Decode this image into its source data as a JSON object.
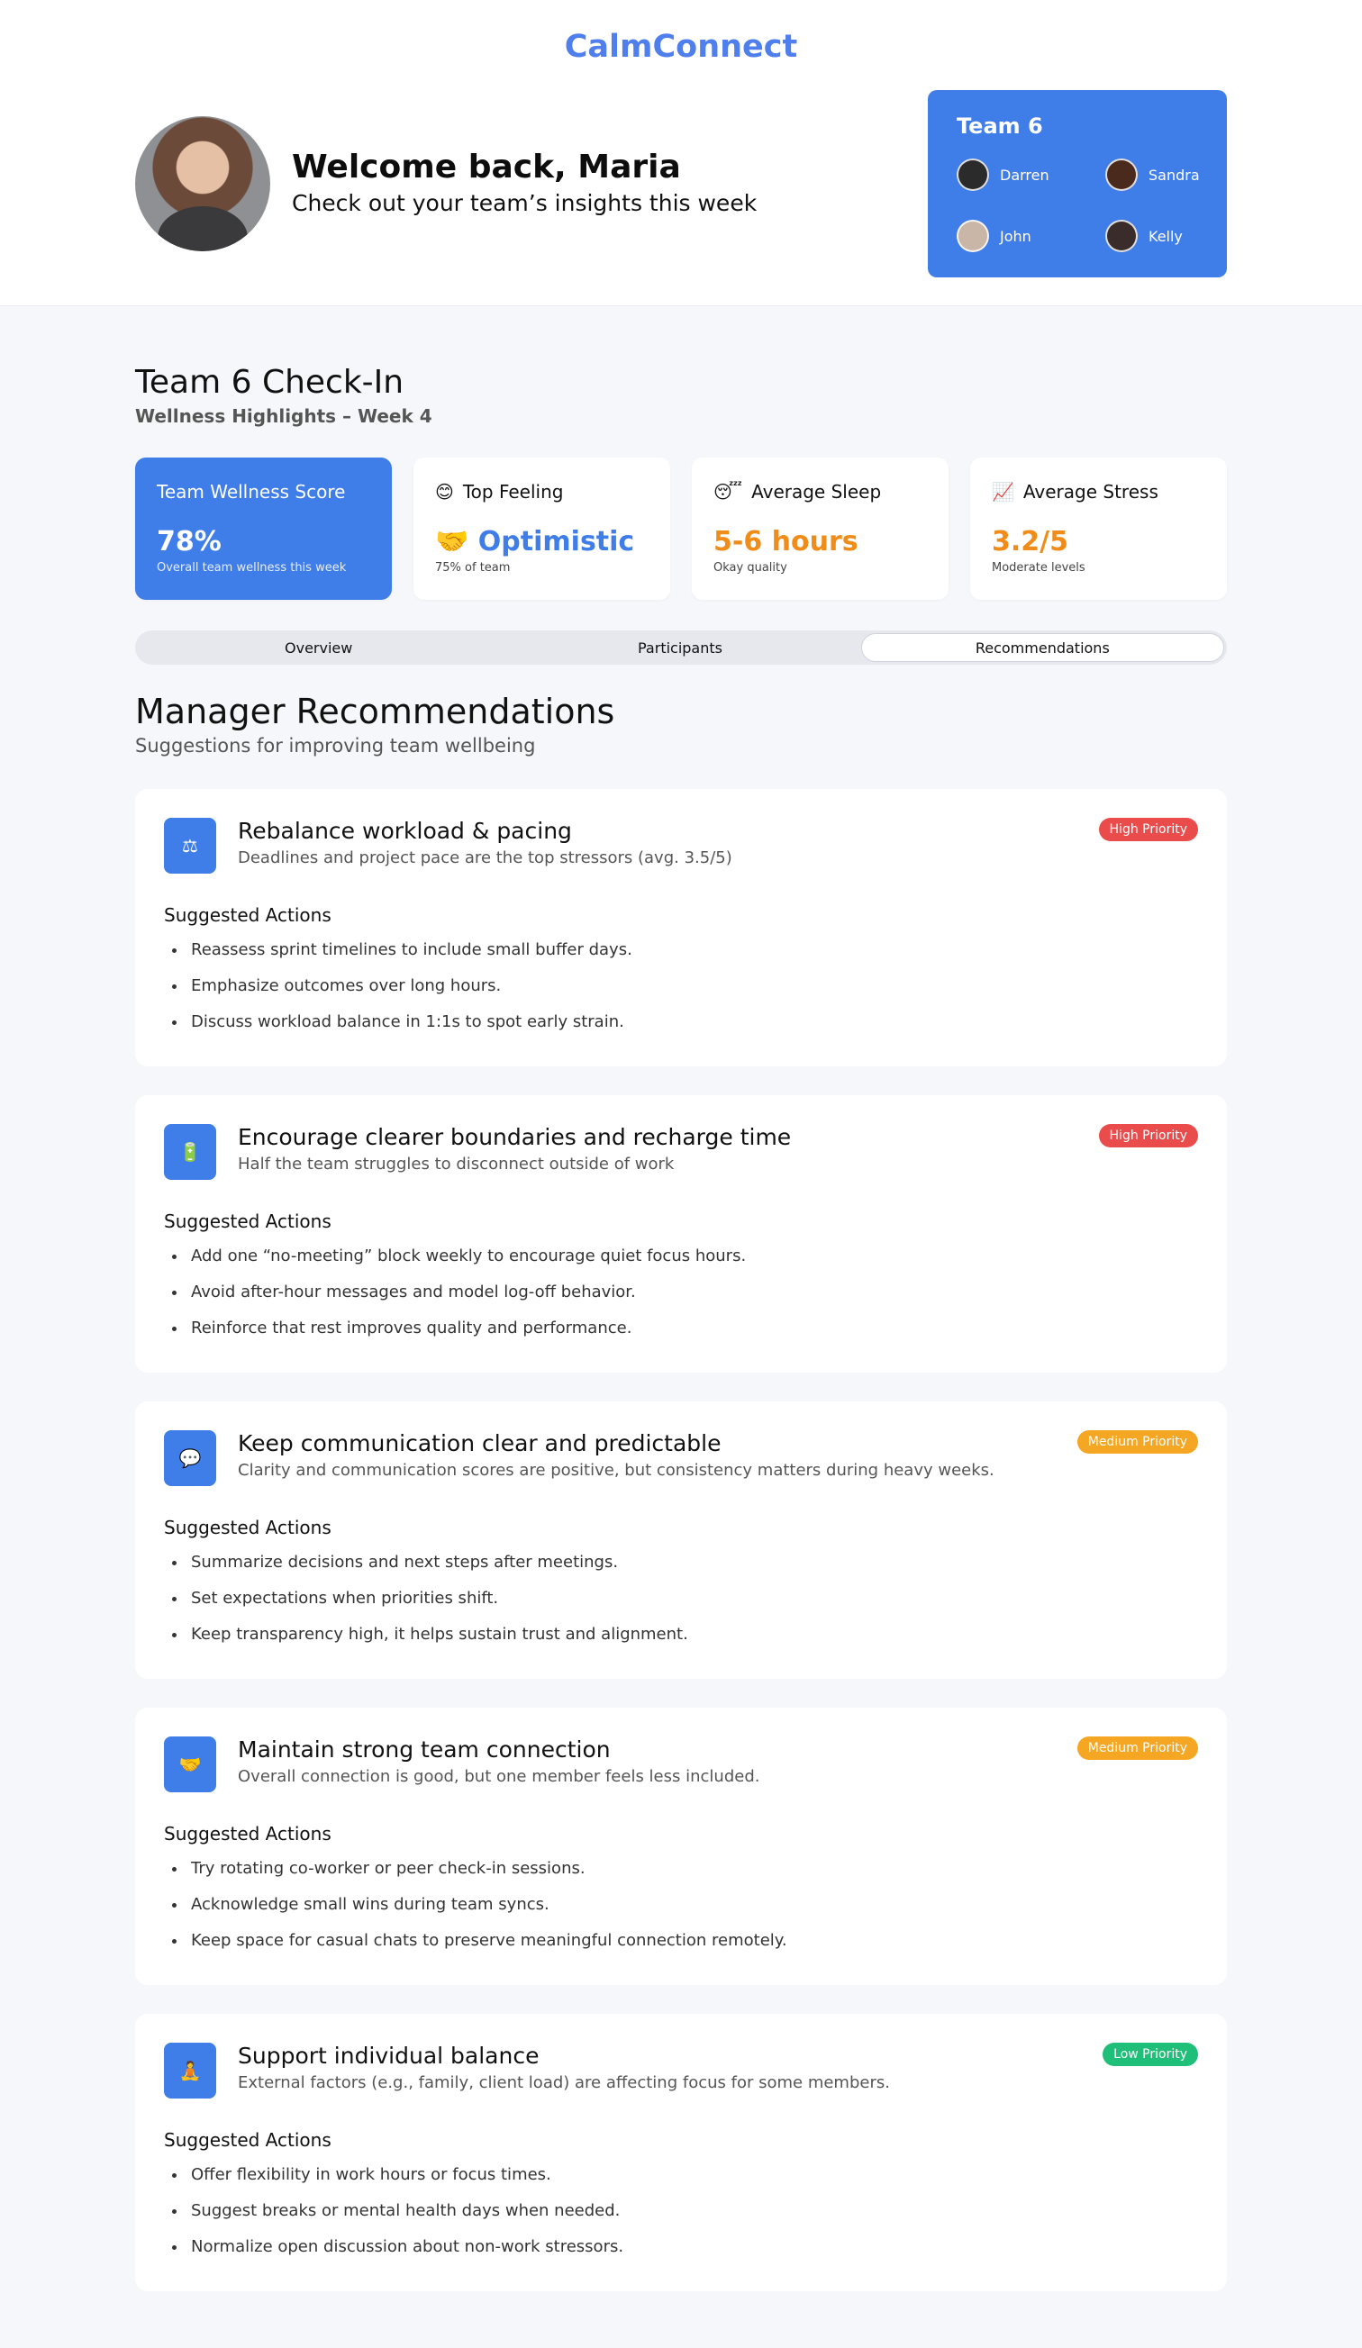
{
  "brand": "CalmConnect",
  "welcome": {
    "title": "Welcome back, Maria",
    "subtitle": "Check out your team’s insights this week"
  },
  "team_card": {
    "title": "Team 6",
    "members": [
      {
        "name": "Darren",
        "color": "#2b2b2b"
      },
      {
        "name": "Sandra",
        "color": "#4a2a1c"
      },
      {
        "name": "John",
        "color": "#c9b6a6"
      },
      {
        "name": "Kelly",
        "color": "#3a2c2a"
      }
    ]
  },
  "checkin": {
    "title": "Team 6 Check-In",
    "subtitle": "Wellness Highlights – Week 4"
  },
  "stats": [
    {
      "icon": "",
      "label": "Team Wellness Score",
      "value": "78%",
      "note": "Overall team wellness this week"
    },
    {
      "icon": "😊",
      "label": "Top Feeling",
      "value": "🤝 Optimistic",
      "note": "75% of team"
    },
    {
      "icon": "😴",
      "label": "Average Sleep",
      "value": "5-6 hours",
      "note": "Okay quality"
    },
    {
      "icon": "📈",
      "label": "Average Stress",
      "value": "3.2/5",
      "note": "Moderate levels"
    }
  ],
  "tabs": [
    "Overview",
    "Participants",
    "Recommendations"
  ],
  "active_tab": "Recommendations",
  "recommendations_header": {
    "title": "Manager Recommendations",
    "subtitle": "Suggestions for improving team wellbeing"
  },
  "actions_label": "Suggested Actions",
  "recommendations": [
    {
      "icon": "⚖",
      "title": "Rebalance workload & pacing",
      "description": "Deadlines and project pace are the top stressors (avg. 3.5/5)",
      "priority": "High Priority",
      "actions": [
        "Reassess sprint timelines to include small buffer days.",
        "Emphasize outcomes over long hours.",
        "Discuss workload balance in 1:1s to spot early strain."
      ]
    },
    {
      "icon": "🔋",
      "title": "Encourage clearer boundaries and recharge time",
      "description": "Half the team struggles to disconnect outside of work",
      "priority": "High Priority",
      "actions": [
        "Add one “no-meeting” block weekly to encourage quiet focus hours.",
        "Avoid after-hour messages and model log-off behavior.",
        "Reinforce that rest improves quality and performance."
      ]
    },
    {
      "icon": "💬",
      "title": "Keep communication clear and predictable",
      "description": "Clarity and communication scores are positive, but consistency matters during heavy weeks.",
      "priority": "Medium Priority",
      "actions": [
        "Summarize decisions and next steps after meetings.",
        "Set expectations when priorities shift.",
        "Keep transparency high, it helps sustain trust and alignment."
      ]
    },
    {
      "icon": "🤝",
      "title": "Maintain strong team connection",
      "description": "Overall connection is good, but one member feels less included.",
      "priority": "Medium Priority",
      "actions": [
        "Try rotating co-worker or peer check-in sessions.",
        "Acknowledge small wins during team syncs.",
        "Keep space for casual chats to preserve meaningful connection remotely."
      ]
    },
    {
      "icon": "🧘",
      "title": "Support individual balance",
      "description": "External factors (e.g., family, client load) are affecting focus for some members.",
      "priority": "Low Priority",
      "actions": [
        "Offer flexibility in work hours or focus times.",
        "Suggest breaks or mental health days when needed.",
        "Normalize open discussion about non-work stressors."
      ]
    }
  ]
}
